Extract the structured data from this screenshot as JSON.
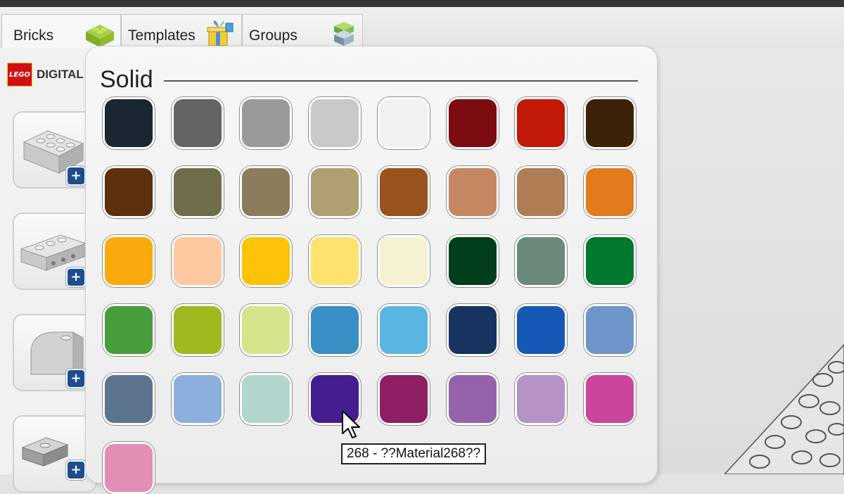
{
  "tabs": [
    {
      "label": "Bricks",
      "icon": "green-brick-icon",
      "active": true
    },
    {
      "label": "Templates",
      "icon": "gift-box-icon",
      "active": false
    },
    {
      "label": "Groups",
      "icon": "stacked-bricks-icon",
      "active": false
    }
  ],
  "brand": {
    "logo": "LEGO",
    "text": "DIGITAL"
  },
  "palette": {
    "section_title": "Solid",
    "selected_index": 43,
    "rows": [
      [
        "#1a2630",
        "#646464",
        "#9a9a9a",
        "#c9c9c9",
        "#f1f1f1",
        "#7d0b12",
        "#c21908",
        "#3b2208"
      ],
      [
        "#5e300d",
        "#706b48",
        "#8b7d5c",
        "#b09f73",
        "#9a531c",
        "#c48761",
        "#b07c54",
        "#e27a1e"
      ],
      [
        "#fbaa0c",
        "#fec9a0",
        "#fcc30a",
        "#fde26e",
        "#f5f2d3",
        "#013e1c",
        "#6c8a7a",
        "#00782d"
      ],
      [
        "#489d3d",
        "#9fba1f",
        "#d6e58c",
        "#3a8fc4",
        "#5bb5e2",
        "#173360",
        "#1559b4",
        "#6e96c9"
      ],
      [
        "#5d7491",
        "#8bb0de",
        "#b1d6d0",
        "#441d8f",
        "#8e1f64",
        "#9463ab",
        "#b493c7",
        "#c9469c"
      ],
      [
        "#e28eb5"
      ]
    ]
  },
  "tooltip": {
    "text": "268 - ??Material268??"
  }
}
